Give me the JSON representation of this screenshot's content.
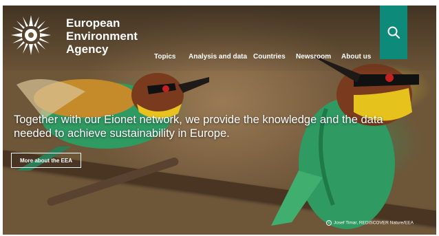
{
  "brand": {
    "line1": "European",
    "line2": "Environment",
    "line3": "Agency"
  },
  "nav": {
    "items": [
      "Topics",
      "Analysis and data",
      "Countries",
      "Newsroom",
      "About us"
    ]
  },
  "search": {
    "icon": "search-icon"
  },
  "hero": {
    "headline": "Together with our Eionet network, we provide the knowledge and the data needed to achieve sustainability in Europe.",
    "cta_label": "More about the EEA"
  },
  "credit": {
    "text": "Josef Timar, REDISCOVER Nature/EEA"
  },
  "colors": {
    "accent": "#0e8a7a",
    "text": "#ffffff"
  }
}
